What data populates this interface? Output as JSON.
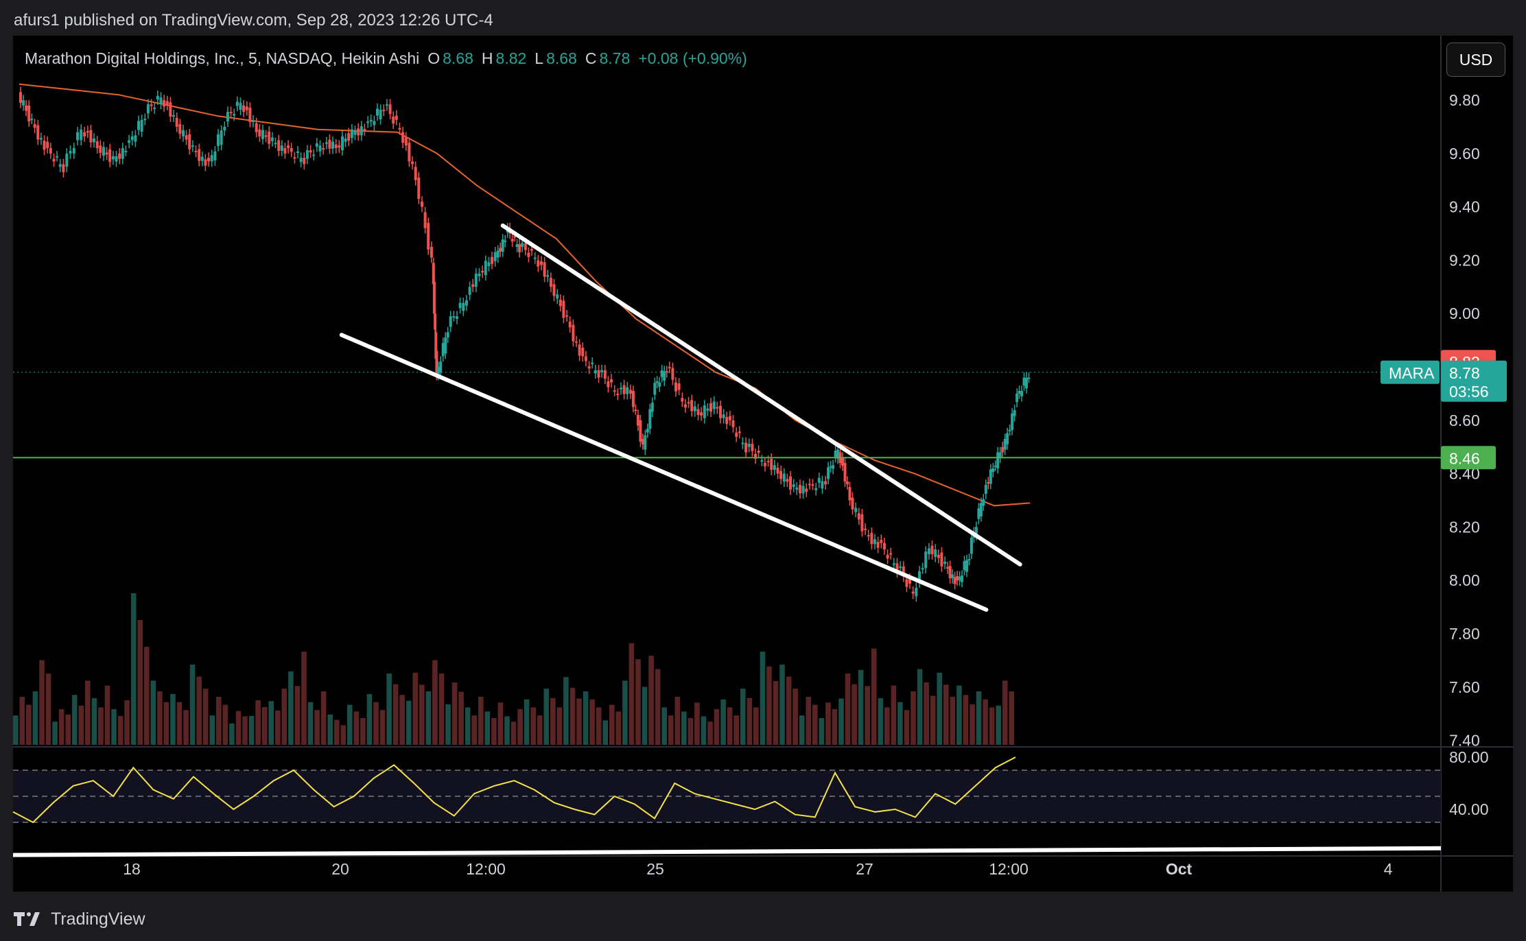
{
  "header": {
    "published": "afurs1 published on TradingView.com, Sep 28, 2023 12:26 UTC-4"
  },
  "legend": {
    "symbol": "Marathon Digital Holdings, Inc., 5, NASDAQ, Heikin Ashi",
    "o_label": "O",
    "o": "8.68",
    "h_label": "H",
    "h": "8.82",
    "l_label": "L",
    "l": "8.68",
    "c_label": "C",
    "c": "8.78",
    "change": "+0.08 (+0.90%)"
  },
  "currency_button": "USD",
  "badges": {
    "high": "8.82",
    "ticker": "MARA",
    "last": "8.78",
    "countdown": "03:56",
    "level": "8.46"
  },
  "footer": {
    "brand": "TradingView"
  },
  "colors": {
    "up": "#26a69a",
    "down": "#ef5350",
    "ma": "#e8652a",
    "level": "#4caf50",
    "rsi": "#f5e34a",
    "trendline": "#ffffff",
    "background": "#000000"
  },
  "chart_data": {
    "type": "candlestick",
    "style": "Heikin Ashi",
    "interval": "5",
    "exchange": "NASDAQ",
    "price_axis": {
      "ticks": [
        "9.80",
        "9.60",
        "9.40",
        "9.20",
        "9.00",
        "8.60",
        "8.40",
        "8.20",
        "8.00",
        "7.80",
        "7.60",
        "7.40"
      ],
      "ylim": [
        7.4,
        9.85
      ]
    },
    "rsi_axis": {
      "ticks": [
        "80.00",
        "40.00"
      ],
      "bands": [
        30,
        50,
        70
      ]
    },
    "x_axis": {
      "ticks": [
        "18",
        "20",
        "12:00",
        "25",
        "27",
        "12:00",
        "Oct",
        "4"
      ],
      "bold": [
        "Oct"
      ]
    },
    "price_path": [
      [
        0,
        9.82
      ],
      [
        0.7,
        9.72
      ],
      [
        1.5,
        9.6
      ],
      [
        2.3,
        9.55
      ],
      [
        3.2,
        9.7
      ],
      [
        4.0,
        9.62
      ],
      [
        4.8,
        9.58
      ],
      [
        5.6,
        9.63
      ],
      [
        6.4,
        9.75
      ],
      [
        7.2,
        9.82
      ],
      [
        8.0,
        9.7
      ],
      [
        8.8,
        9.62
      ],
      [
        9.6,
        9.55
      ],
      [
        10.4,
        9.72
      ],
      [
        11.2,
        9.8
      ],
      [
        12.0,
        9.68
      ],
      [
        12.8,
        9.65
      ],
      [
        13.6,
        9.6
      ],
      [
        14.4,
        9.58
      ],
      [
        15.2,
        9.64
      ],
      [
        16.0,
        9.62
      ],
      [
        16.8,
        9.68
      ],
      [
        17.6,
        9.7
      ],
      [
        18.4,
        9.78
      ],
      [
        19.2,
        9.7
      ],
      [
        20.0,
        9.5
      ],
      [
        20.8,
        9.2
      ],
      [
        21.0,
        8.75
      ],
      [
        21.6,
        8.95
      ],
      [
        22.4,
        9.05
      ],
      [
        23.2,
        9.15
      ],
      [
        24.0,
        9.22
      ],
      [
        24.6,
        9.3
      ],
      [
        25.2,
        9.25
      ],
      [
        26.0,
        9.22
      ],
      [
        26.8,
        9.1
      ],
      [
        27.6,
        8.98
      ],
      [
        28.4,
        8.82
      ],
      [
        29.2,
        8.78
      ],
      [
        30.0,
        8.72
      ],
      [
        30.8,
        8.7
      ],
      [
        31.4,
        8.5
      ],
      [
        32.0,
        8.72
      ],
      [
        32.6,
        8.8
      ],
      [
        33.4,
        8.68
      ],
      [
        34.2,
        8.62
      ],
      [
        35.0,
        8.66
      ],
      [
        35.8,
        8.58
      ],
      [
        36.6,
        8.5
      ],
      [
        37.4,
        8.46
      ],
      [
        38.2,
        8.4
      ],
      [
        39.0,
        8.35
      ],
      [
        39.8,
        8.34
      ],
      [
        40.6,
        8.38
      ],
      [
        41.2,
        8.5
      ],
      [
        41.8,
        8.3
      ],
      [
        42.6,
        8.18
      ],
      [
        43.4,
        8.12
      ],
      [
        44.2,
        8.05
      ],
      [
        45.0,
        7.96
      ],
      [
        45.8,
        8.12
      ],
      [
        46.6,
        8.06
      ],
      [
        47.2,
        7.98
      ],
      [
        47.8,
        8.1
      ],
      [
        48.4,
        8.3
      ],
      [
        49.0,
        8.42
      ],
      [
        49.6,
        8.52
      ],
      [
        50.2,
        8.68
      ],
      [
        50.8,
        8.78
      ]
    ],
    "ma_path": [
      [
        0,
        9.86
      ],
      [
        5,
        9.82
      ],
      [
        10,
        9.74
      ],
      [
        15,
        9.69
      ],
      [
        19,
        9.68
      ],
      [
        21,
        9.6
      ],
      [
        23,
        9.48
      ],
      [
        25,
        9.38
      ],
      [
        27,
        9.28
      ],
      [
        29,
        9.12
      ],
      [
        31,
        8.98
      ],
      [
        33,
        8.88
      ],
      [
        35,
        8.78
      ],
      [
        37,
        8.72
      ],
      [
        39,
        8.6
      ],
      [
        41,
        8.52
      ],
      [
        43,
        8.45
      ],
      [
        45,
        8.4
      ],
      [
        47,
        8.34
      ],
      [
        49,
        8.28
      ],
      [
        50.8,
        8.29
      ]
    ],
    "level_line": 8.46,
    "trendlines": {
      "upper": [
        [
          24.3,
          9.33
        ],
        [
          50.3,
          8.06
        ]
      ],
      "lower": [
        [
          16.2,
          8.92
        ],
        [
          48.6,
          7.89
        ]
      ],
      "rsi_support": [
        [
          0,
          26
        ],
        [
          66.4,
          28
        ]
      ]
    },
    "volume_relative": [
      0.3,
      0.5,
      0.2,
      0.4,
      0.35,
      0.25,
      1.0,
      0.4,
      0.3,
      0.45,
      0.3,
      0.2,
      0.25,
      0.35,
      0.55,
      0.3,
      0.2,
      0.25,
      0.3,
      0.4,
      0.45,
      0.5,
      0.35,
      0.3,
      0.25,
      0.2,
      0.3,
      0.35,
      0.4,
      0.3,
      0.25,
      0.6,
      0.5,
      0.3,
      0.25,
      0.2,
      0.3,
      0.35,
      0.55,
      0.45,
      0.3,
      0.25,
      0.4,
      0.6,
      0.35,
      0.3,
      0.5,
      0.45,
      0.35,
      0.3,
      0.4
    ],
    "rsi": [
      38,
      30,
      45,
      58,
      62,
      50,
      72,
      55,
      48,
      65,
      52,
      40,
      50,
      62,
      70,
      55,
      42,
      50,
      64,
      74,
      60,
      45,
      35,
      52,
      58,
      62,
      55,
      45,
      40,
      36,
      50,
      44,
      33,
      60,
      52,
      48,
      44,
      40,
      46,
      36,
      34,
      68,
      42,
      38,
      40,
      34,
      52,
      44,
      58,
      72,
      80
    ]
  }
}
